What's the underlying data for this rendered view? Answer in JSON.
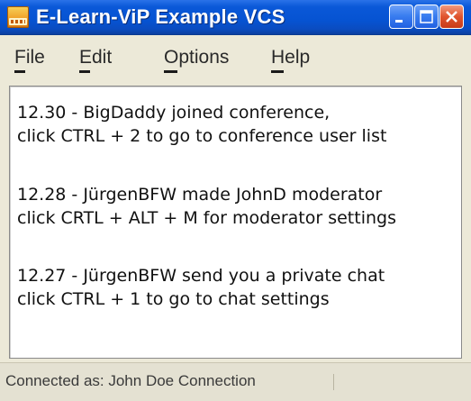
{
  "window": {
    "title": "E-Learn-ViP Example VCS",
    "icon": "vcs-app-icon",
    "controls": [
      "minimize",
      "maximize",
      "close"
    ]
  },
  "menu": {
    "items": [
      {
        "label": "File",
        "mnemonic": "F"
      },
      {
        "label": "Edit",
        "mnemonic": "E"
      },
      {
        "label": "Options",
        "mnemonic": "O"
      },
      {
        "label": "Help",
        "mnemonic": "H"
      }
    ]
  },
  "messages": [
    {
      "line1": "12.30 - BigDaddy joined conference,",
      "line2": "click CTRL + 2 to go to conference user list"
    },
    {
      "line1": "12.28 - JürgenBFW made JohnD moderator",
      "line2": "click CRTL + ALT + M for moderator settings"
    },
    {
      "line1": "12.27 - JürgenBFW send you a private chat",
      "line2": "click CTRL + 1 to go to chat settings"
    }
  ],
  "status": {
    "text": "Connected as: John Doe  Connection"
  },
  "colors": {
    "titlebar": "#0653d2",
    "close_button": "#e0542e",
    "window_bg": "#ece9d8",
    "content_bg": "#ffffff"
  }
}
